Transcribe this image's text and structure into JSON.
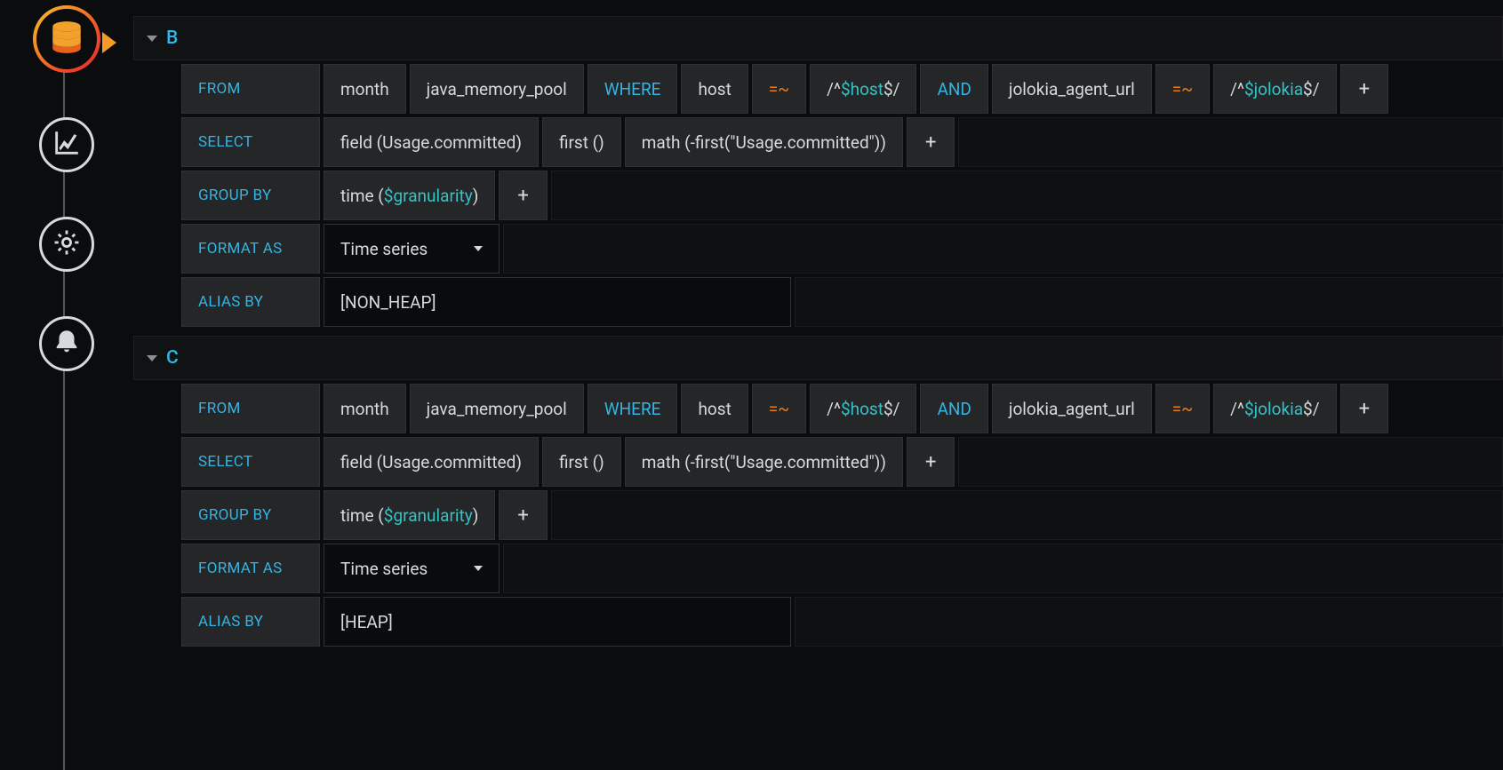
{
  "sidebar": {
    "items": [
      {
        "name": "database-icon"
      },
      {
        "name": "graph-icon"
      },
      {
        "name": "settings-icon"
      },
      {
        "name": "bell-icon"
      }
    ]
  },
  "queries": [
    {
      "id": "B",
      "from": {
        "label": "FROM",
        "policy": "month",
        "measurement": "java_memory_pool",
        "where_kw": "WHERE",
        "conditions": [
          {
            "field": "host",
            "op": "=~",
            "regex_pre": "/^",
            "regex_var": "$host",
            "regex_post": "$/"
          },
          {
            "join": "AND",
            "field": "jolokia_agent_url",
            "op": "=~",
            "regex_pre": "/^",
            "regex_var": "$jolokia",
            "regex_post": "$/"
          }
        ]
      },
      "select": {
        "label": "SELECT",
        "parts": [
          "field (Usage.committed)",
          "first ()",
          "math (-first(\"Usage.committed\"))"
        ]
      },
      "groupby": {
        "label": "GROUP BY",
        "time_pre": "time (",
        "time_var": "$granularity",
        "time_post": ")"
      },
      "format": {
        "label": "FORMAT AS",
        "value": "Time series"
      },
      "alias": {
        "label": "ALIAS BY",
        "value": "[NON_HEAP]"
      }
    },
    {
      "id": "C",
      "from": {
        "label": "FROM",
        "policy": "month",
        "measurement": "java_memory_pool",
        "where_kw": "WHERE",
        "conditions": [
          {
            "field": "host",
            "op": "=~",
            "regex_pre": "/^",
            "regex_var": "$host",
            "regex_post": "$/"
          },
          {
            "join": "AND",
            "field": "jolokia_agent_url",
            "op": "=~",
            "regex_pre": "/^",
            "regex_var": "$jolokia",
            "regex_post": "$/"
          }
        ]
      },
      "select": {
        "label": "SELECT",
        "parts": [
          "field (Usage.committed)",
          "first ()",
          "math (-first(\"Usage.committed\"))"
        ]
      },
      "groupby": {
        "label": "GROUP BY",
        "time_pre": "time (",
        "time_var": "$granularity",
        "time_post": ")"
      },
      "format": {
        "label": "FORMAT AS",
        "value": "Time series"
      },
      "alias": {
        "label": "ALIAS BY",
        "value": "[HEAP]"
      }
    }
  ],
  "plus_label": "+"
}
